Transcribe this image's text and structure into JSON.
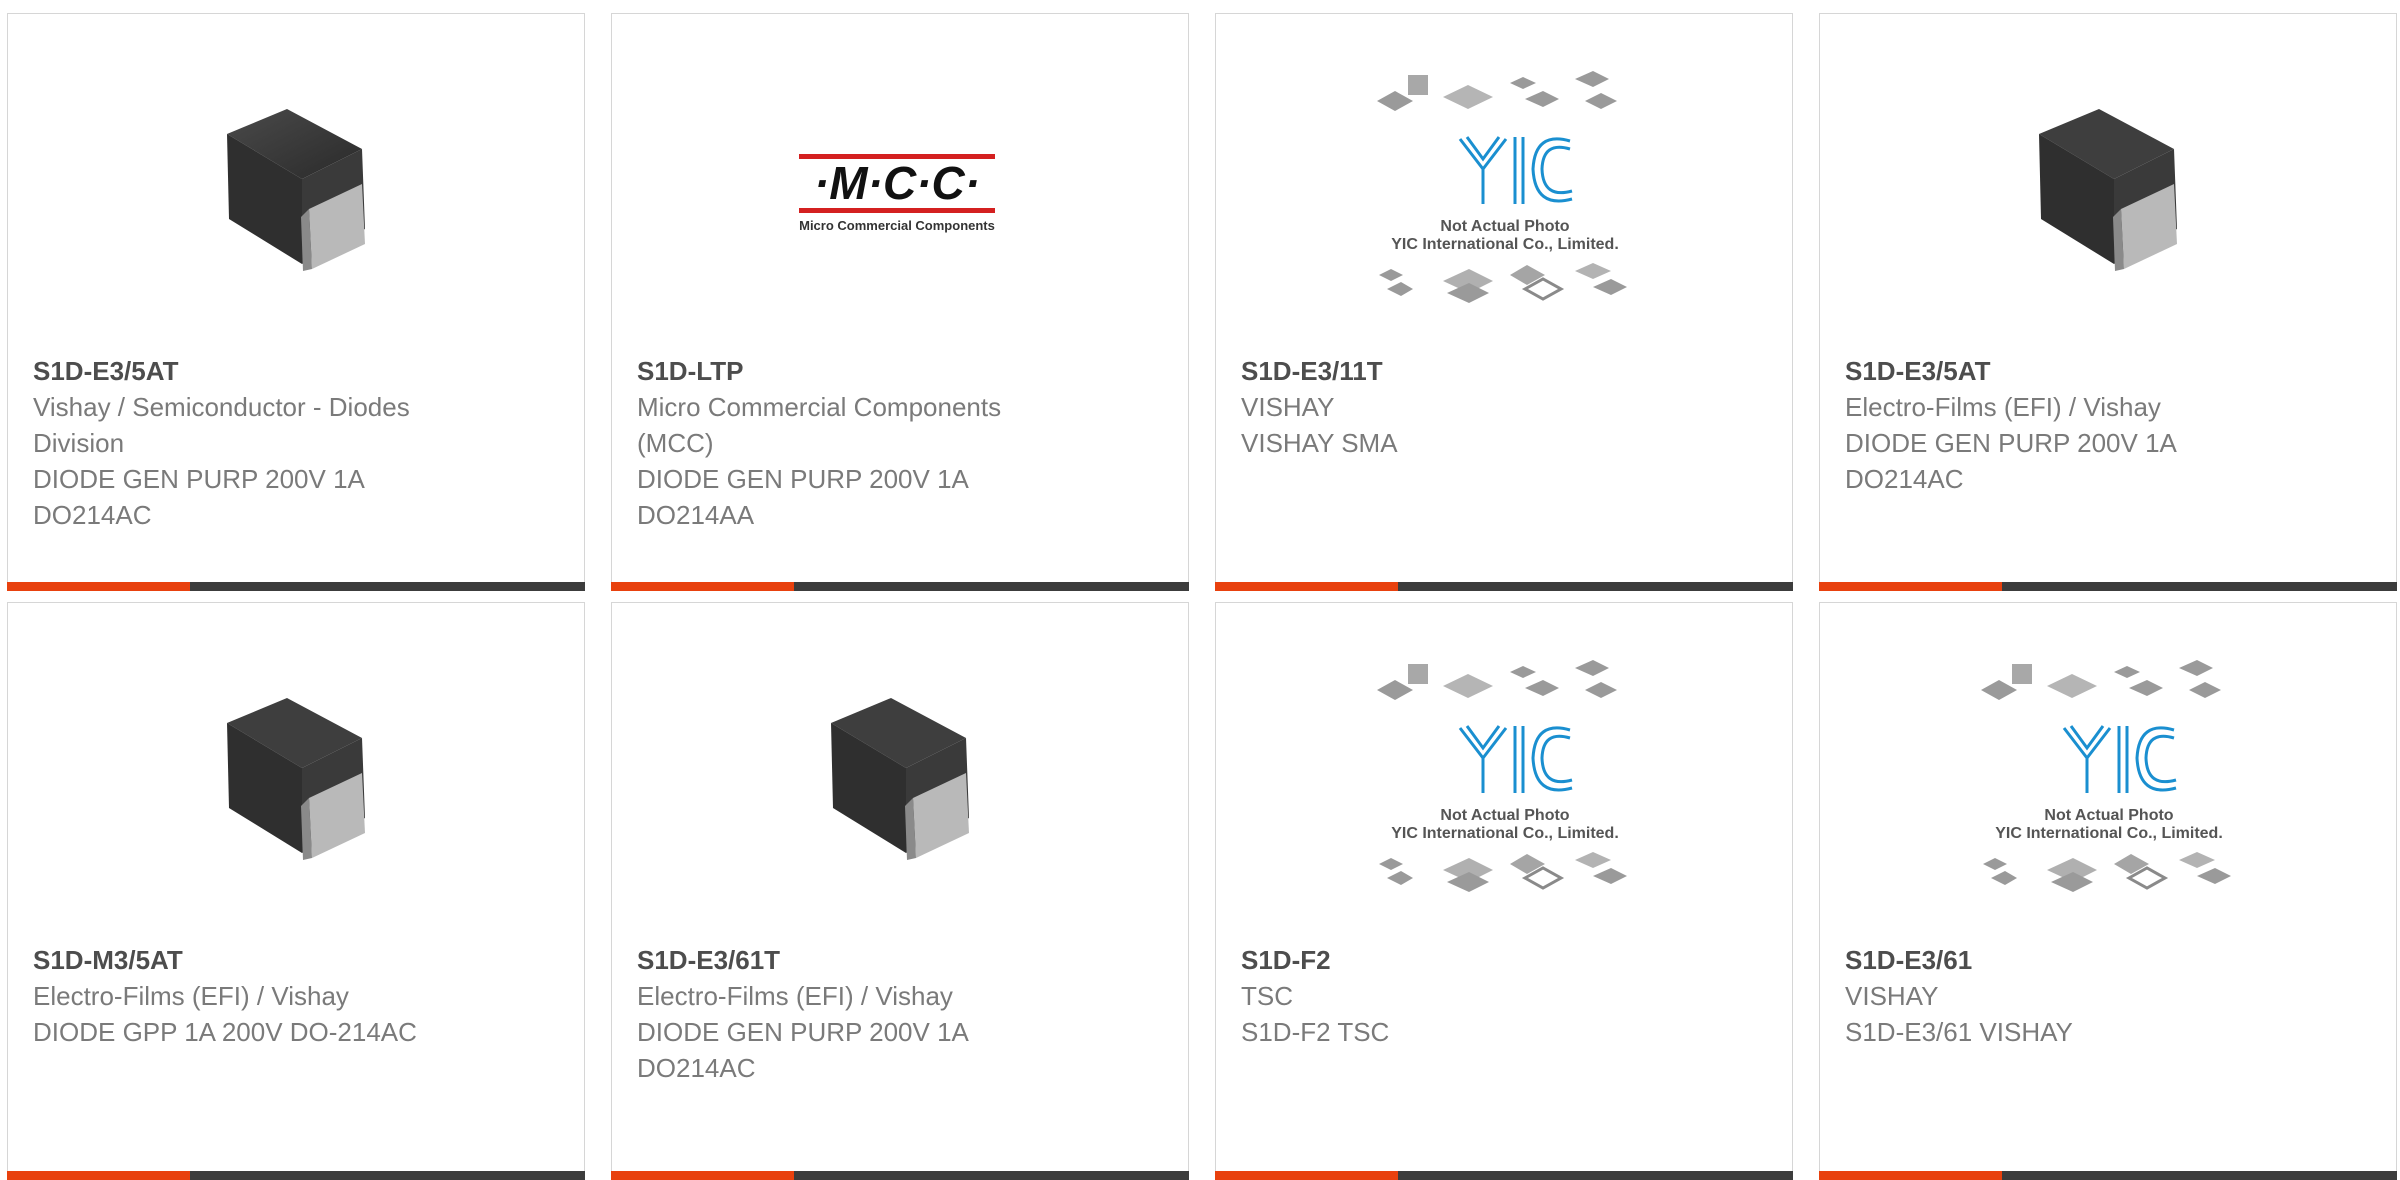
{
  "products": [
    {
      "part_number": "S1D-E3/5AT",
      "lines": [
        "Vishay / Semiconductor - Diodes",
        "Division",
        "DIODE GEN PURP 200V 1A",
        "DO214AC"
      ],
      "image": "diode-package-photo"
    },
    {
      "part_number": "S1D-LTP",
      "lines": [
        "Micro Commercial Components",
        "(MCC)",
        "DIODE GEN PURP 200V 1A",
        "DO214AA"
      ],
      "image": "mcc-logo",
      "logo_text": "·M·C·C·",
      "logo_subtext": "Micro Commercial Components"
    },
    {
      "part_number": "S1D-E3/11T",
      "lines": [
        "VISHAY",
        "VISHAY SMA"
      ],
      "image": "yic-placeholder",
      "placeholder_line1": "Not Actual Photo",
      "placeholder_line2": "YIC International Co., Limited."
    },
    {
      "part_number": "S1D-E3/5AT",
      "lines": [
        "Electro-Films (EFI) / Vishay",
        "DIODE GEN PURP 200V 1A",
        "DO214AC"
      ],
      "image": "diode-package-photo"
    },
    {
      "part_number": "S1D-M3/5AT",
      "lines": [
        "Electro-Films (EFI) / Vishay",
        "DIODE GPP 1A 200V DO-214AC"
      ],
      "image": "diode-package-photo"
    },
    {
      "part_number": "S1D-E3/61T",
      "lines": [
        "Electro-Films (EFI) / Vishay",
        "DIODE GEN PURP 200V 1A",
        "DO214AC"
      ],
      "image": "diode-package-photo"
    },
    {
      "part_number": "S1D-F2",
      "lines": [
        "TSC",
        "S1D-F2 TSC"
      ],
      "image": "yic-placeholder",
      "placeholder_line1": "Not Actual Photo",
      "placeholder_line2": "YIC International Co., Limited."
    },
    {
      "part_number": "S1D-E3/61",
      "lines": [
        "VISHAY",
        "S1D-E3/61 VISHAY"
      ],
      "image": "yic-placeholder",
      "placeholder_line1": "Not Actual Photo",
      "placeholder_line2": "YIC International Co., Limited."
    }
  ],
  "colors": {
    "accent": "#e8410e",
    "bar": "#3c3c3c",
    "part_number": "#4d4d4d",
    "text": "#7a7a7a",
    "border": "#d6d6d6",
    "yic_logo": "#1a8fd0"
  }
}
